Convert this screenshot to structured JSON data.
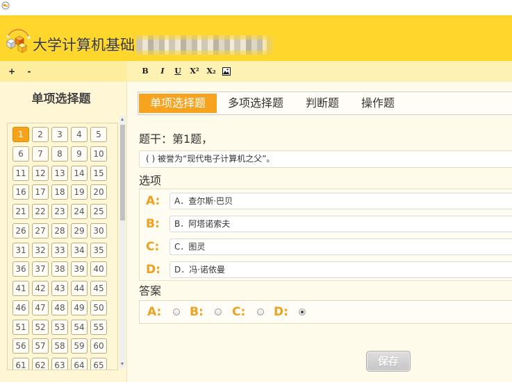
{
  "app": {
    "title": "大学计算机基础"
  },
  "toolbar": {
    "zoom_in": "+",
    "zoom_out": "-",
    "bold": "B",
    "italic": "I",
    "underline": "U",
    "superscript": "X²",
    "subscript": "X₂",
    "image_icon": "image-icon"
  },
  "sidebar": {
    "title": "单项选择题",
    "active_question": 1,
    "questions": [
      "1",
      "2",
      "3",
      "4",
      "5",
      "6",
      "7",
      "8",
      "9",
      "10",
      "11",
      "12",
      "13",
      "14",
      "15",
      "16",
      "17",
      "18",
      "19",
      "20",
      "21",
      "22",
      "23",
      "24",
      "25",
      "26",
      "27",
      "28",
      "29",
      "30",
      "31",
      "32",
      "33",
      "34",
      "35",
      "36",
      "37",
      "38",
      "39",
      "40",
      "41",
      "42",
      "43",
      "44",
      "45",
      "46",
      "47",
      "48",
      "49",
      "50",
      "51",
      "52",
      "53",
      "54",
      "55",
      "56",
      "57",
      "58",
      "59",
      "60",
      "61",
      "62",
      "63",
      "64",
      "65"
    ]
  },
  "tabs": [
    {
      "label": "单项选择题",
      "active": true
    },
    {
      "label": "多项选择题",
      "active": false
    },
    {
      "label": "判断题",
      "active": false
    },
    {
      "label": "操作题",
      "active": false
    }
  ],
  "stem": {
    "label": "题干：第1题，",
    "text": "( ) 被誉为“现代电子计算机之父”。"
  },
  "options": {
    "label": "选项",
    "items": [
      {
        "letter": "A:",
        "text": "A．查尔斯·巴贝"
      },
      {
        "letter": "B:",
        "text": "B．阿塔诺索夫"
      },
      {
        "letter": "C:",
        "text": "C．图灵"
      },
      {
        "letter": "D:",
        "text": "D．冯·诺依曼"
      }
    ]
  },
  "answer": {
    "label": "答案",
    "choices": [
      {
        "letter": "A:",
        "selected": false
      },
      {
        "letter": "B:",
        "selected": false
      },
      {
        "letter": "C:",
        "selected": false
      },
      {
        "letter": "D:",
        "selected": true
      }
    ]
  },
  "save_label": "保存",
  "colors": {
    "header": "#fed62c",
    "accent": "#f5a21c",
    "option_letter": "#f0a01c"
  }
}
